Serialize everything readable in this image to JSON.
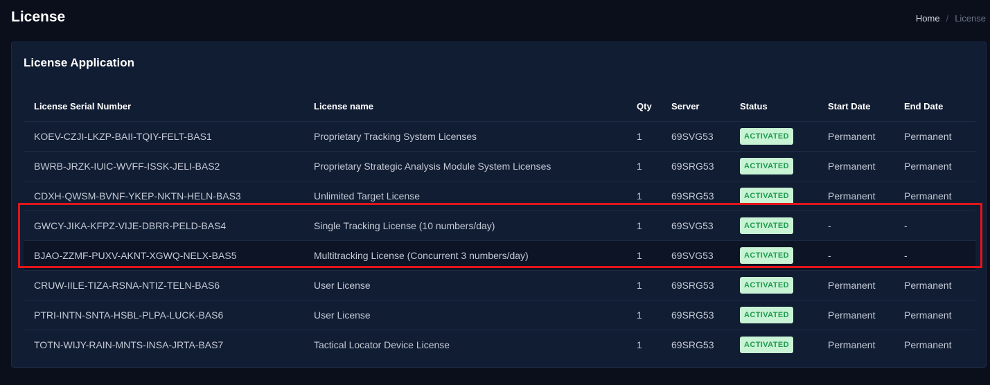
{
  "header": {
    "title": "License",
    "breadcrumb": {
      "home": "Home",
      "separator": "/",
      "current": "License"
    }
  },
  "card": {
    "title": "License Application"
  },
  "table": {
    "columns": [
      "License Serial Number",
      "License name",
      "Qty",
      "Server",
      "Status",
      "Start Date",
      "End Date"
    ],
    "rows": [
      {
        "serial": "KOEV-CZJI-LKZP-BAII-TQIY-FELT-BAS1",
        "name": "Proprietary Tracking System Licenses",
        "qty": "1",
        "server": "69SVG53",
        "status": "ACTIVATED",
        "start": "Permanent",
        "end": "Permanent"
      },
      {
        "serial": "BWRB-JRZK-IUIC-WVFF-ISSK-JELI-BAS2",
        "name": "Proprietary Strategic Analysis Module System Licenses",
        "qty": "1",
        "server": "69SRG53",
        "status": "ACTIVATED",
        "start": "Permanent",
        "end": "Permanent"
      },
      {
        "serial": "CDXH-QWSM-BVNF-YKEP-NKTN-HELN-BAS3",
        "name": "Unlimited Target License",
        "qty": "1",
        "server": "69SRG53",
        "status": "ACTIVATED",
        "start": "Permanent",
        "end": "Permanent"
      },
      {
        "serial": "GWCY-JIKA-KFPZ-VIJE-DBRR-PELD-BAS4",
        "name": "Single Tracking License (10 numbers/day)",
        "qty": "1",
        "server": "69SVG53",
        "status": "ACTIVATED",
        "start": "-",
        "end": "-"
      },
      {
        "serial": "BJAO-ZZMF-PUXV-AKNT-XGWQ-NELX-BAS5",
        "name": "Multitracking License (Concurrent 3 numbers/day)",
        "qty": "1",
        "server": "69SVG53",
        "status": "ACTIVATED",
        "start": "-",
        "end": "-"
      },
      {
        "serial": "CRUW-IILE-TIZA-RSNA-NTIZ-TELN-BAS6",
        "name": "User License",
        "qty": "1",
        "server": "69SRG53",
        "status": "ACTIVATED",
        "start": "Permanent",
        "end": "Permanent"
      },
      {
        "serial": "PTRI-INTN-SNTA-HSBL-PLPA-LUCK-BAS6",
        "name": "User License",
        "qty": "1",
        "server": "69SRG53",
        "status": "ACTIVATED",
        "start": "Permanent",
        "end": "Permanent"
      },
      {
        "serial": "TOTN-WIJY-RAIN-MNTS-INSA-JRTA-BAS7",
        "name": "Tactical Locator Device License",
        "qty": "1",
        "server": "69SRG53",
        "status": "ACTIVATED",
        "start": "Permanent",
        "end": "Permanent"
      }
    ]
  },
  "colors": {
    "background": "#0b0f1c",
    "card": "#111d33",
    "badge_bg": "#c8f3d4",
    "badge_text": "#1e9b4f",
    "highlight": "#e0151b"
  }
}
